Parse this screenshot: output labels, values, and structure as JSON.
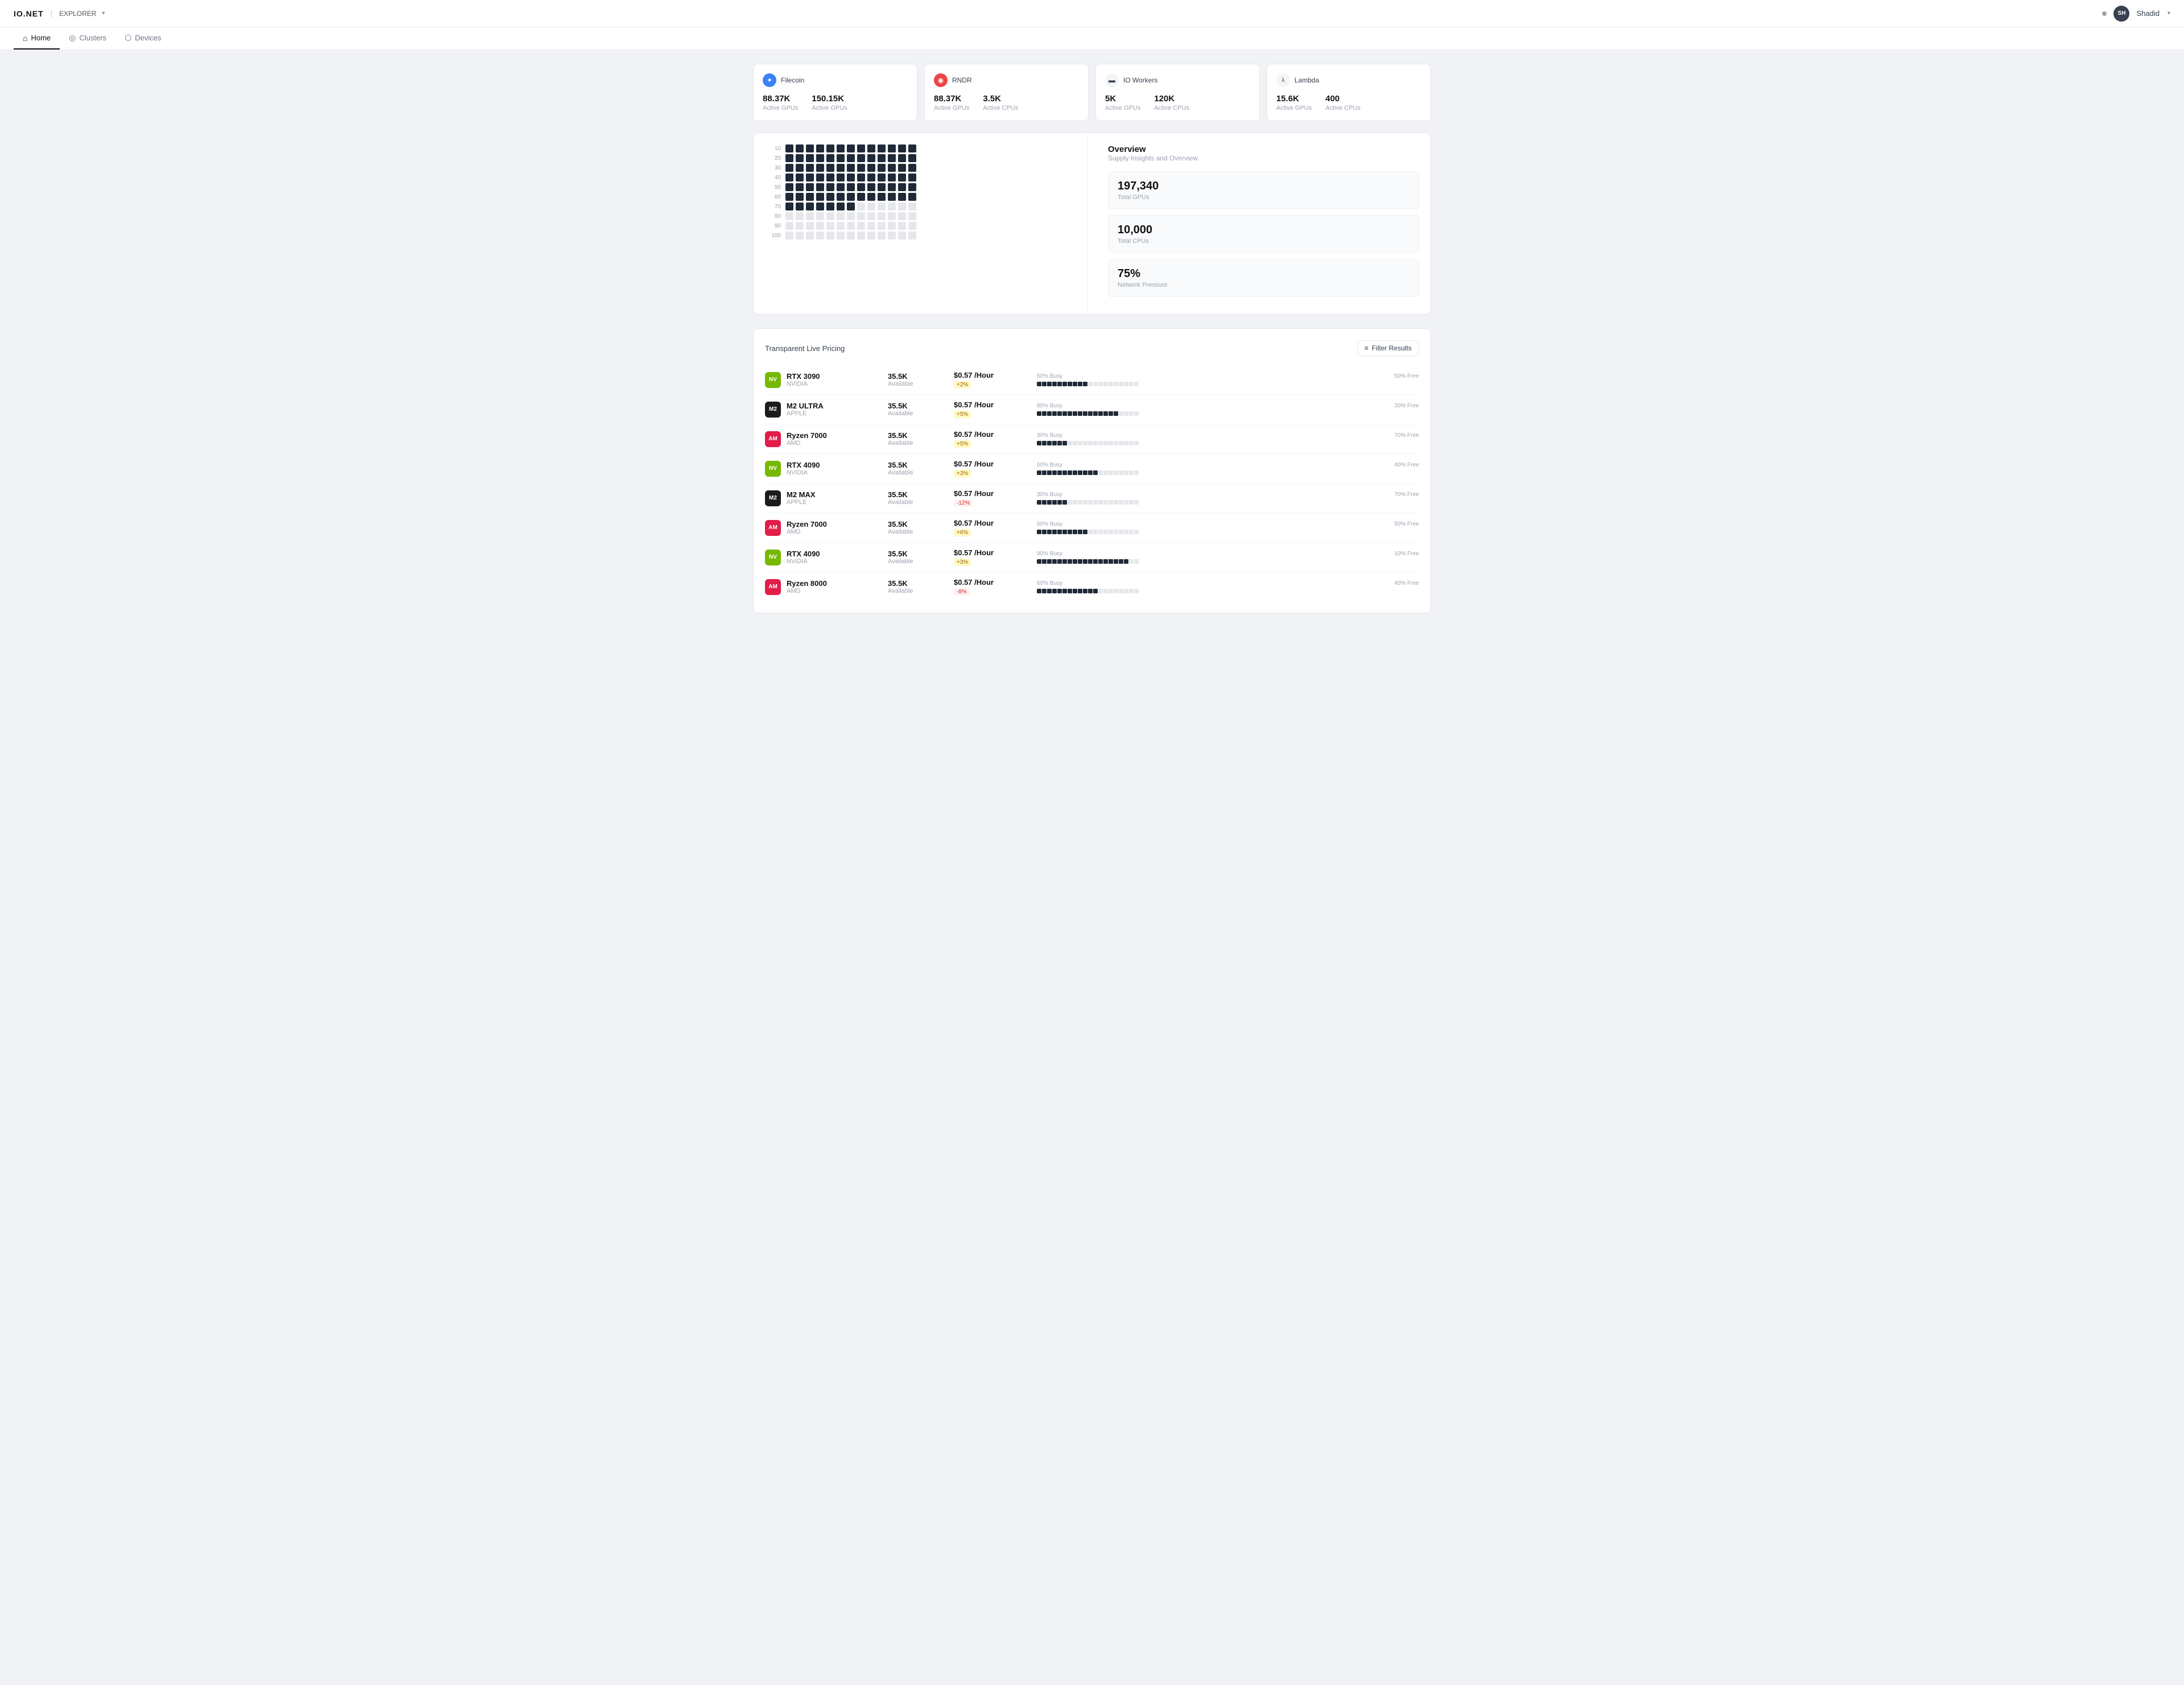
{
  "brand": {
    "logo": "IO.NET",
    "separator": "|",
    "product": "EXPLORER",
    "chevron": "▾"
  },
  "topnav": {
    "notification_icon": "●",
    "avatar_initials": "SH",
    "user_name": "Shadid",
    "user_chevron": "▾"
  },
  "subnav": {
    "items": [
      {
        "id": "home",
        "label": "Home",
        "icon": "⌂",
        "active": true
      },
      {
        "id": "clusters",
        "label": "Clusters",
        "icon": "◎",
        "active": false
      },
      {
        "id": "devices",
        "label": "Devices",
        "icon": "⬡",
        "active": false
      }
    ]
  },
  "stat_cards": [
    {
      "id": "filecoin",
      "icon": "✦",
      "icon_class": "icon-filecoin",
      "name": "Filecoin",
      "stats": [
        {
          "num": "88.37K",
          "label": "Active GPUs"
        },
        {
          "num": "150.15K",
          "label": "Active GPUs"
        }
      ]
    },
    {
      "id": "rndr",
      "icon": "◉",
      "icon_class": "icon-rndr",
      "name": "RNDR",
      "stats": [
        {
          "num": "88.37K",
          "label": "Active GPUs"
        },
        {
          "num": "3.5K",
          "label": "Active CPUs"
        }
      ]
    },
    {
      "id": "io-workers",
      "icon": "▬",
      "icon_class": "icon-io",
      "name": "IO Workers",
      "stats": [
        {
          "num": "5K",
          "label": "Active GPUs"
        },
        {
          "num": "120K",
          "label": "Active CPUs"
        }
      ]
    },
    {
      "id": "lambda",
      "icon": "λ",
      "icon_class": "icon-lambda",
      "name": "Lambda",
      "stats": [
        {
          "num": "15.6K",
          "label": "Active GPUs"
        },
        {
          "num": "400",
          "label": "Active CPUs"
        }
      ]
    }
  ],
  "overview": {
    "title": "Overview",
    "subtitle": "Supply Insights and Overview",
    "stats": [
      {
        "num": "197,340",
        "label": "Total GPUs"
      },
      {
        "num": "10,000",
        "label": "Total CPUs"
      },
      {
        "num": "75%",
        "label": "Network Pressure"
      }
    ]
  },
  "grid_rows": [
    {
      "label": "10",
      "filled": 13,
      "empty": 0
    },
    {
      "label": "20",
      "filled": 13,
      "empty": 0
    },
    {
      "label": "30",
      "filled": 13,
      "empty": 0
    },
    {
      "label": "40",
      "filled": 13,
      "empty": 0
    },
    {
      "label": "50",
      "filled": 13,
      "empty": 0
    },
    {
      "label": "60",
      "filled": 13,
      "empty": 0
    },
    {
      "label": "70",
      "filled": 7,
      "empty": 6
    },
    {
      "label": "80",
      "filled": 0,
      "empty": 13
    },
    {
      "label": "90",
      "filled": 0,
      "empty": 13
    },
    {
      "label": "100",
      "filled": 0,
      "empty": 13
    }
  ],
  "pricing": {
    "title": "Transparent Live Pricing",
    "filter_label": "Filter Results",
    "filter_icon": "≡",
    "rows": [
      {
        "logo": "NV",
        "logo_class": "logo-nvidia",
        "name": "RTX 3090",
        "brand": "NVIDIA",
        "count": "35.5K",
        "avail": "Available",
        "price": "$0.57 /Hour",
        "change": "+2%",
        "change_class": "price-up",
        "busy_pct": 50,
        "free_pct": 50,
        "busy_label": "50% Busy",
        "free_label": "50% Free"
      },
      {
        "logo": "M2",
        "logo_class": "logo-apple",
        "name": "M2 ULTRA",
        "brand": "APPLE",
        "count": "35.5K",
        "avail": "Available",
        "price": "$0.57 /Hour",
        "change": "+5%",
        "change_class": "price-up",
        "busy_pct": 80,
        "free_pct": 20,
        "busy_label": "80% Busy",
        "free_label": "20% Free"
      },
      {
        "logo": "AM",
        "logo_class": "logo-amd",
        "name": "Ryzen 7000",
        "brand": "AMD",
        "count": "35.5K",
        "avail": "Available",
        "price": "$0.57 /Hour",
        "change": "+5%",
        "change_class": "price-up",
        "busy_pct": 30,
        "free_pct": 70,
        "busy_label": "30% Busy",
        "free_label": "70% Free"
      },
      {
        "logo": "NV",
        "logo_class": "logo-nvidia",
        "name": "RTX 4090",
        "brand": "NVIDIA",
        "count": "35.5K",
        "avail": "Available",
        "price": "$0.57 /Hour",
        "change": "+3%",
        "change_class": "price-up",
        "busy_pct": 60,
        "free_pct": 40,
        "busy_label": "60% Busy",
        "free_label": "40% Free"
      },
      {
        "logo": "M2",
        "logo_class": "logo-apple",
        "name": "M2 MAX",
        "brand": "APPLE",
        "count": "35.5K",
        "avail": "Available",
        "price": "$0.57 /Hour",
        "change": "-12%",
        "change_class": "price-down",
        "busy_pct": 30,
        "free_pct": 70,
        "busy_label": "30% Busy",
        "free_label": "70% Free"
      },
      {
        "logo": "AM",
        "logo_class": "logo-amd",
        "name": "Ryzen 7000",
        "brand": "AMD",
        "count": "35.5K",
        "avail": "Available",
        "price": "$0.57 /Hour",
        "change": "+6%",
        "change_class": "price-up",
        "busy_pct": 50,
        "free_pct": 50,
        "busy_label": "50% Busy",
        "free_label": "50% Free"
      },
      {
        "logo": "NV",
        "logo_class": "logo-nvidia",
        "name": "RTX 4090",
        "brand": "NVIDIA",
        "count": "35.5K",
        "avail": "Available",
        "price": "$0.57 /Hour",
        "change": "+3%",
        "change_class": "price-up",
        "busy_pct": 90,
        "free_pct": 10,
        "busy_label": "90% Busy",
        "free_label": "10% Free"
      },
      {
        "logo": "AM",
        "logo_class": "logo-amd",
        "name": "Ryzen 8000",
        "brand": "AMD",
        "count": "35.5K",
        "avail": "Available",
        "price": "$0.57 /Hour",
        "change": "-8%",
        "change_class": "price-down",
        "busy_pct": 60,
        "free_pct": 40,
        "busy_label": "60% Busy",
        "free_label": "40% Free"
      }
    ]
  }
}
